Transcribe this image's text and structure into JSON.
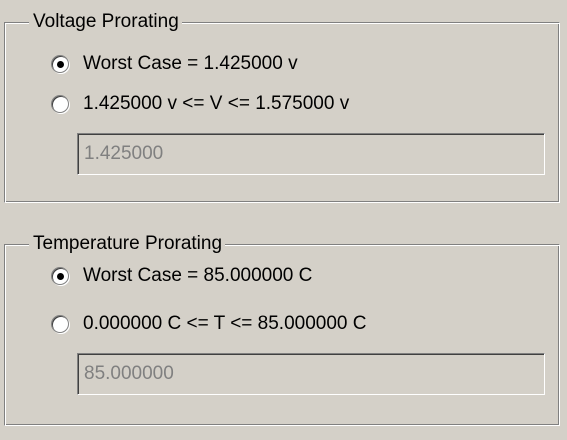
{
  "voltage": {
    "title": "Voltage Prorating",
    "worst_case_label": "Worst Case = 1.425000 v",
    "worst_case_selected": true,
    "range_label": "1.425000 v <= V <= 1.575000 v",
    "range_selected": false,
    "value": "1.425000"
  },
  "temperature": {
    "title": "Temperature Prorating",
    "worst_case_label": "Worst Case = 85.000000 C",
    "worst_case_selected": true,
    "range_label": "0.000000 C <= T <= 85.000000 C",
    "range_selected": false,
    "value": "85.000000"
  }
}
